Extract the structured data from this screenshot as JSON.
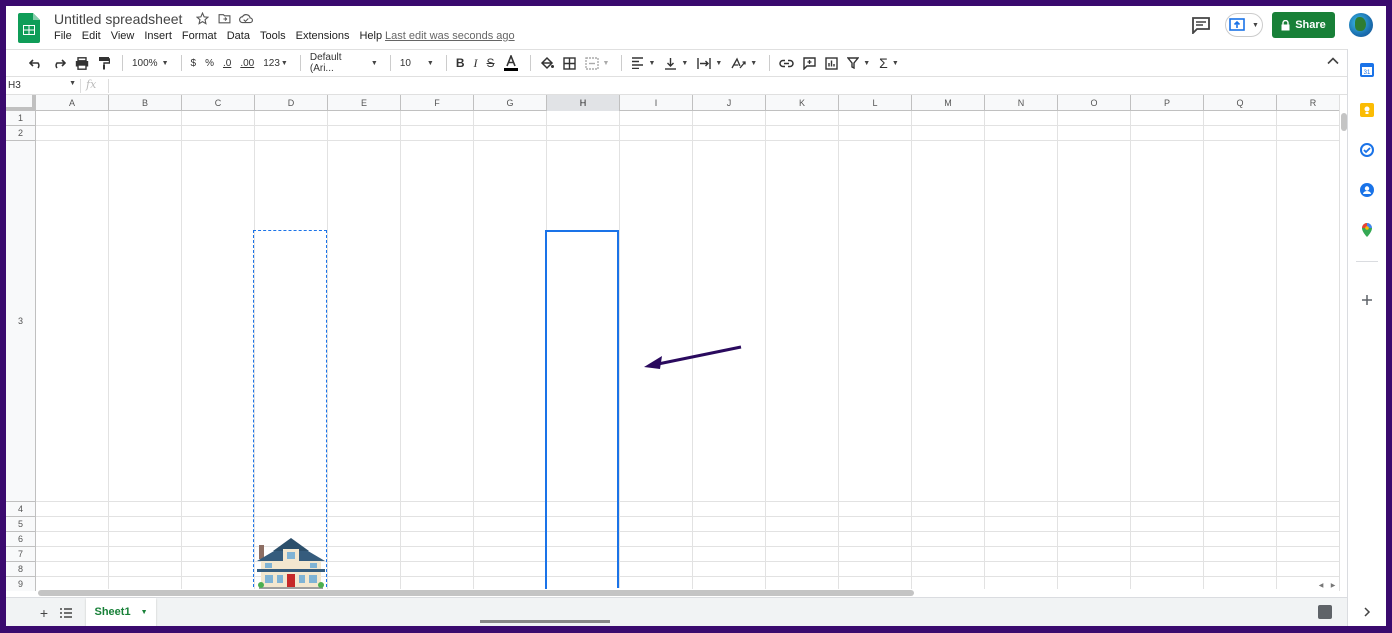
{
  "app": {
    "title": "Untitled spreadsheet",
    "last_edit": "Last edit was seconds ago",
    "share_label": "Share"
  },
  "menu": [
    "File",
    "Edit",
    "View",
    "Insert",
    "Format",
    "Data",
    "Tools",
    "Extensions",
    "Help"
  ],
  "toolbar": {
    "zoom": "100%",
    "currency": "$",
    "percent": "%",
    "dec_decrease": ".0",
    "dec_increase": ".00",
    "number_format": "123",
    "font": "Default (Ari...",
    "font_size": "10"
  },
  "formula_bar": {
    "cell_ref": "H3",
    "fx": "fx",
    "value": ""
  },
  "grid": {
    "columns": [
      "A",
      "B",
      "C",
      "D",
      "E",
      "F",
      "G",
      "H",
      "I",
      "J",
      "K",
      "L",
      "M",
      "N",
      "O",
      "P",
      "Q",
      "R"
    ],
    "rows": [
      "1",
      "2",
      "3",
      "4",
      "5",
      "6",
      "7",
      "8",
      "9"
    ],
    "selected_column": "H",
    "selected_cell": "H3",
    "copied_cell": "D3",
    "copied_content": "house-image"
  },
  "sheets": [
    {
      "name": "Sheet1"
    }
  ],
  "colors": {
    "accent": "#1a73e8",
    "share": "#188038",
    "arrow": "#2a0a5e",
    "frame": "#3a0a6e"
  }
}
